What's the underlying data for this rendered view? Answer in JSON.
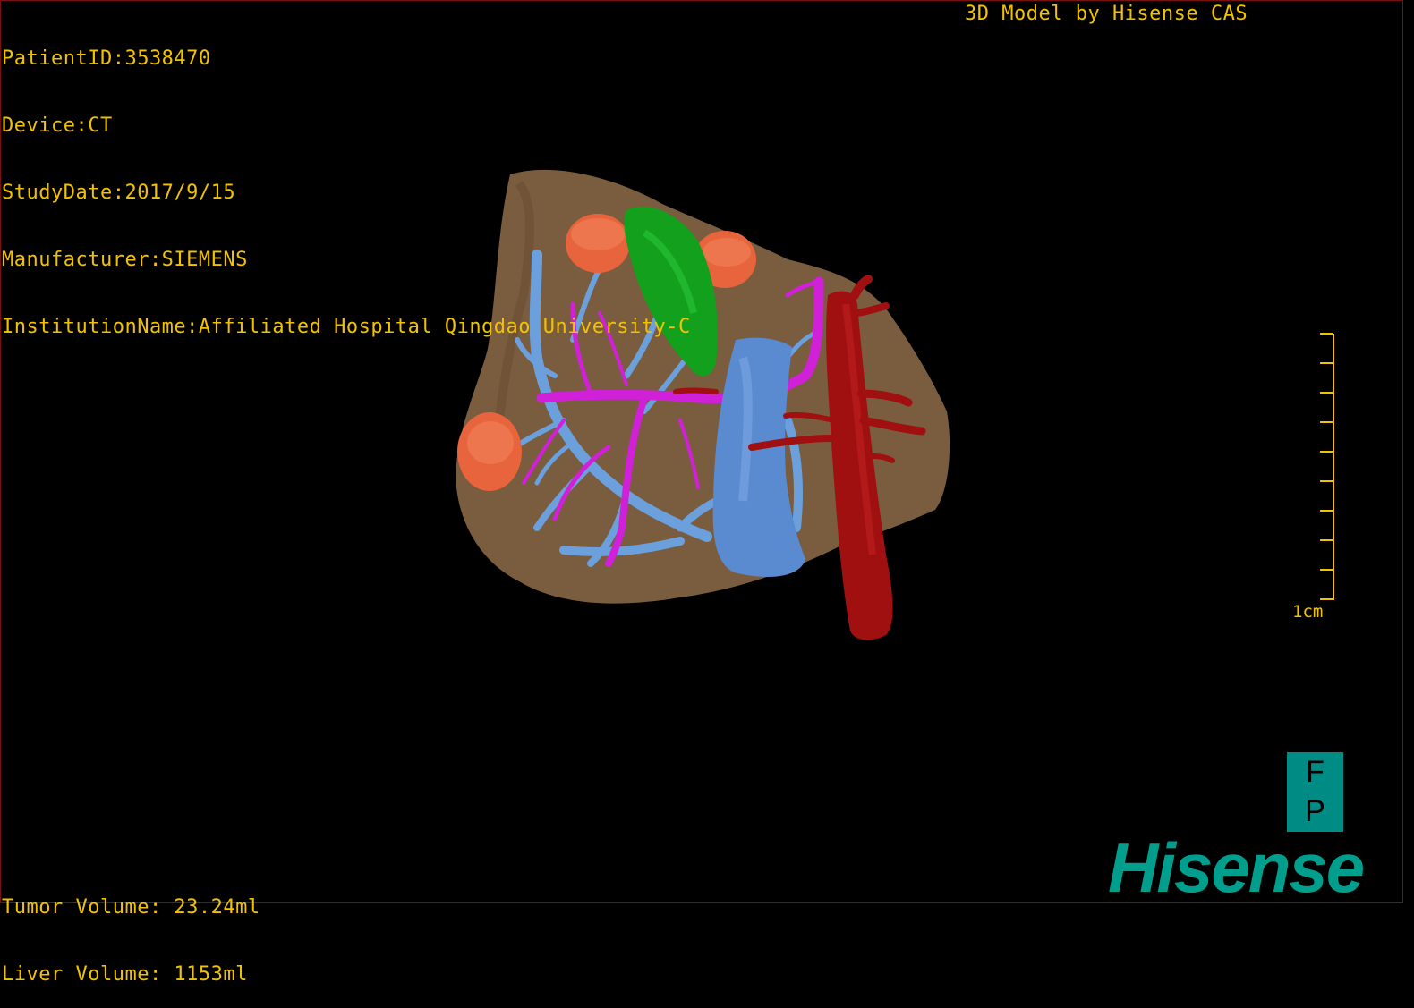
{
  "info": {
    "patient_id": "PatientID:3538470",
    "device": "Device:CT",
    "study_date": "StudyDate:2017/9/15",
    "manufacturer": "Manufacturer:SIEMENS",
    "institution": "InstitutionName:Affiliated Hospital Qingdao University-C"
  },
  "credit": "3D Model by Hisense CAS",
  "volumes": {
    "tumor": "Tumor Volume: 23.24ml",
    "liver": "Liver Volume: 1153ml"
  },
  "scale": {
    "label": "1cm"
  },
  "orientation": {
    "top": "F",
    "bottom": "P"
  },
  "brand": "Hisense",
  "colors": {
    "overlay_text": "#f2c200",
    "liver": "#7a5c3e",
    "tumor": "#e8643c",
    "gallbladder": "#13a01c",
    "portal_vein": "#6ba0dc",
    "hepatic_artery": "#d020d8",
    "aorta": "#a01010",
    "vena_cava": "#5a8ad0",
    "brand": "#009e8c"
  }
}
